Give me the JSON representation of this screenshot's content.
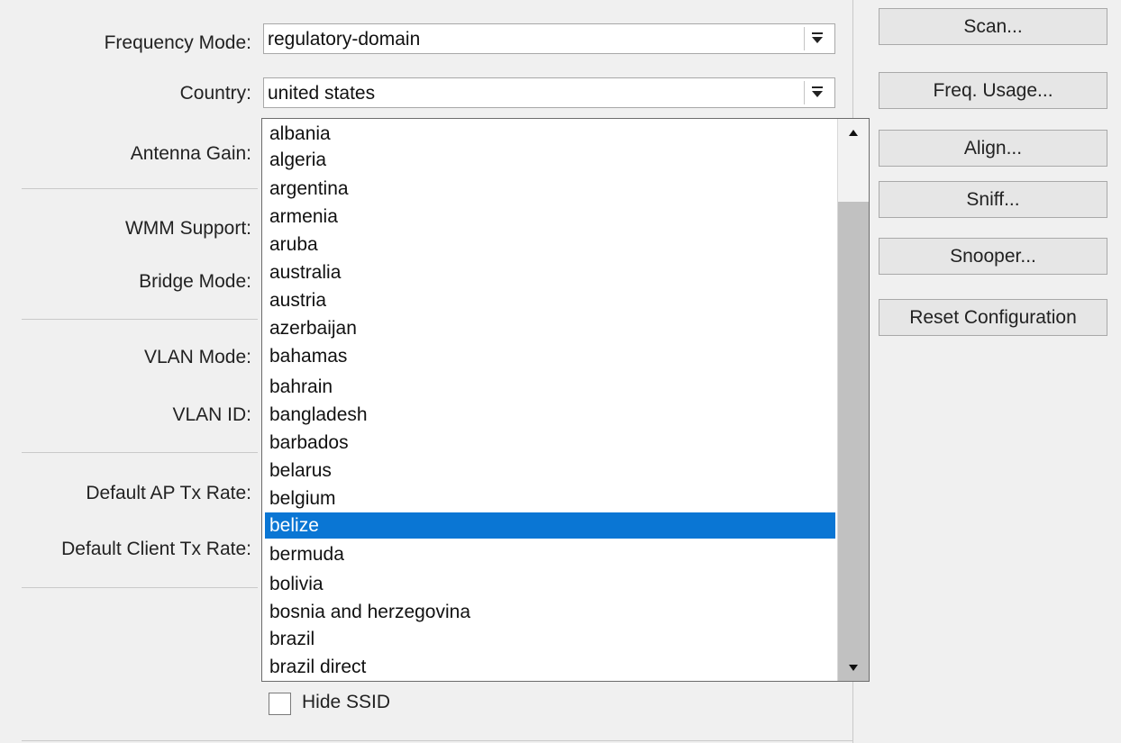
{
  "form": {
    "frequency_mode": {
      "label": "Frequency Mode:",
      "value": "regulatory-domain"
    },
    "country": {
      "label": "Country:",
      "value": "united states"
    },
    "antenna_gain": {
      "label": "Antenna Gain:"
    },
    "wmm_support": {
      "label": "WMM Support:"
    },
    "bridge_mode": {
      "label": "Bridge Mode:"
    },
    "vlan_mode": {
      "label": "VLAN Mode:"
    },
    "vlan_id": {
      "label": "VLAN ID:"
    },
    "default_ap_tx_rate": {
      "label": "Default AP Tx Rate:"
    },
    "default_client_tx_rate": {
      "label": "Default Client Tx Rate:"
    },
    "hide_ssid": {
      "label": "Hide SSID",
      "checked": false
    }
  },
  "buttons": {
    "scan": "Scan...",
    "freq_usage": "Freq. Usage...",
    "align": "Align...",
    "sniff": "Sniff...",
    "snooper": "Snooper...",
    "reset_configuration": "Reset Configuration"
  },
  "country_dropdown": {
    "options": [
      "albania",
      "algeria",
      "argentina",
      "armenia",
      "aruba",
      "australia",
      "austria",
      "azerbaijan",
      "bahamas",
      "bahrain",
      "bangladesh",
      "barbados",
      "belarus",
      "belgium",
      "belize",
      "bermuda",
      "bolivia",
      "bosnia and herzegovina",
      "brazil",
      "brazil direct"
    ],
    "highlighted": "belize"
  },
  "icons": {
    "dropdown_arrow": "chevron-down-bar-icon",
    "scroll_up": "arrow-up-icon",
    "scroll_down": "arrow-down-icon"
  },
  "colors": {
    "selection": "#0a76d4",
    "background": "#f0f0f0"
  }
}
